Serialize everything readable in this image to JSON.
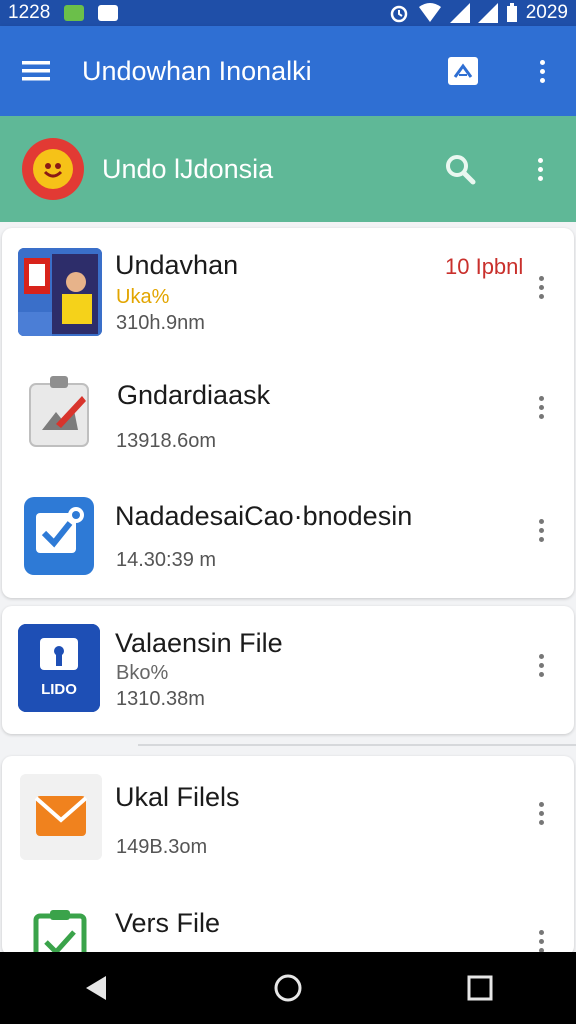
{
  "status_bar": {
    "time": "1228",
    "clock_right": "2029"
  },
  "app_bar": {
    "title": "Undowhan Inonalki",
    "icons": [
      "menu-icon",
      "pdf-icon",
      "more-vert-icon"
    ]
  },
  "sub_bar": {
    "title": "Undo lJdonsia",
    "icons": [
      "account-badge-icon",
      "search-icon",
      "more-vert-icon"
    ]
  },
  "files": [
    {
      "name": "Undavhan",
      "tag": "Uka%",
      "meta": "310h.9nm",
      "size": "10 Ipbnl",
      "icon": "photo-thumbnail"
    },
    {
      "name": "Gndardiaask",
      "meta": "13918.6om",
      "icon": "image-edit-icon"
    },
    {
      "name": "NadadesaiCao·bnodesin",
      "meta": "14.30:39 m",
      "icon": "task-check-icon"
    },
    {
      "name": "Valaensin File",
      "tag": "Bko%",
      "meta": "1310.38m",
      "icon": "document-lock-icon",
      "icon_label": "LIDO"
    },
    {
      "name": "Ukal Filels",
      "meta": "149B.3om",
      "icon": "mail-icon"
    },
    {
      "name": "Vers File",
      "icon": "clipboard-check-icon"
    }
  ],
  "nav": [
    "back-icon",
    "home-icon",
    "recents-icon"
  ],
  "colors": {
    "status": "#1f4fa8",
    "appbar": "#2f6fd3",
    "subbar": "#5fb897",
    "accent_red": "#c9302c",
    "tag_yellow": "#e2a500"
  }
}
